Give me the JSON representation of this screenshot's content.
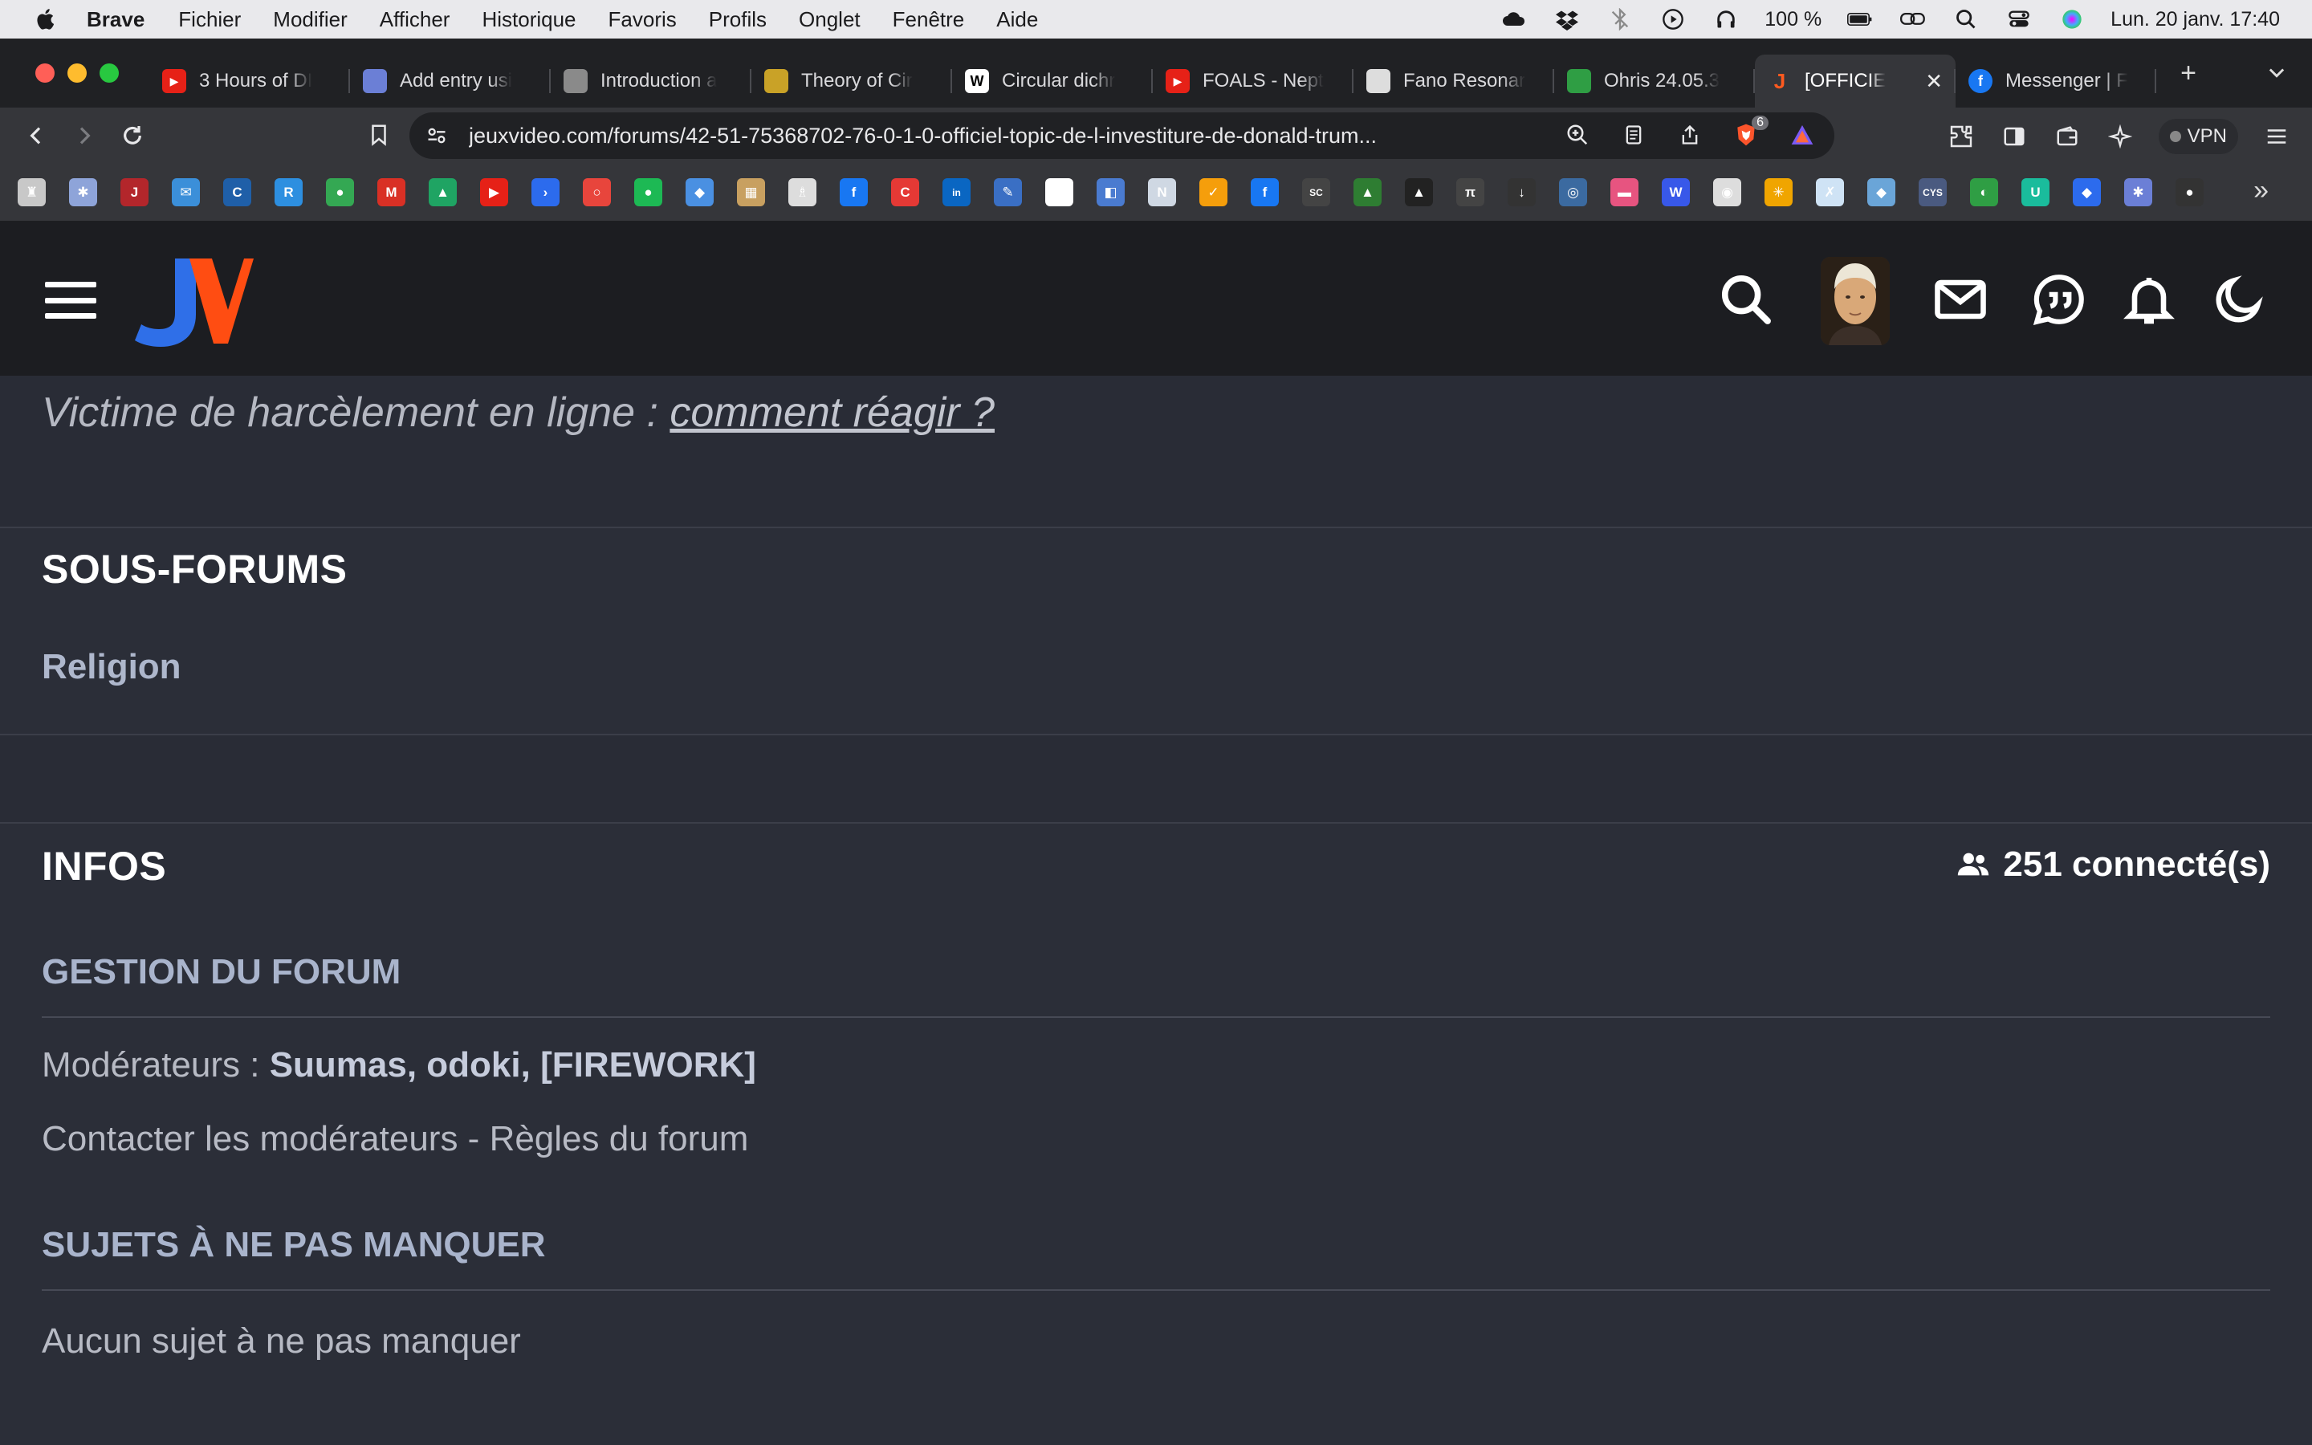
{
  "menubar": {
    "app": "Brave",
    "items": [
      "Fichier",
      "Modifier",
      "Afficher",
      "Historique",
      "Favoris",
      "Profils",
      "Onglet",
      "Fenêtre",
      "Aide"
    ],
    "battery": "100 %",
    "datetime": "Lun. 20 janv.  17:40"
  },
  "tabs": [
    {
      "label": "3 Hours of DI",
      "icon": "youtube-icon",
      "color": "#e62117"
    },
    {
      "label": "Add entry usi",
      "icon": "zotero-icon",
      "color": "#6b7fd6"
    },
    {
      "label": "Introduction a",
      "icon": "globe-icon",
      "color": "#8a8a8a"
    },
    {
      "label": "Theory of Cir",
      "icon": "compass-icon",
      "color": "#c9a227"
    },
    {
      "label": "Circular dichr",
      "icon": "wikipedia-icon",
      "color": "#ffffff"
    },
    {
      "label": "FOALS - Nept",
      "icon": "youtube-icon",
      "color": "#e62117"
    },
    {
      "label": "Fano Resonar",
      "icon": "document-icon",
      "color": "#dddddd"
    },
    {
      "label": "Ohris 24.05.3",
      "icon": "ohris-icon",
      "color": "#2f9e44"
    },
    {
      "label": "[OFFICIE",
      "icon": "jv-icon",
      "color": "#ff5a1f",
      "active": true
    },
    {
      "label": "Messenger | F",
      "icon": "facebook-icon",
      "color": "#1877f2"
    }
  ],
  "address": {
    "url": "jeuxvideo.com/forums/42-51-75368702-76-0-1-0-officiel-topic-de-l-investiture-de-donald-trum...",
    "brave_badge": "6",
    "vpn_label": "VPN"
  },
  "bookmarks": [
    {
      "icon": "bookmark-1-icon",
      "color": "#c8c8c8",
      "glyph": "♜"
    },
    {
      "icon": "bookmark-2-icon",
      "color": "#8ea4d9",
      "glyph": "✱"
    },
    {
      "icon": "bookmark-3-icon",
      "color": "#b3262b",
      "glyph": "J"
    },
    {
      "icon": "bookmark-4-icon",
      "color": "#3b8fd9",
      "glyph": "✉"
    },
    {
      "icon": "bookmark-5-icon",
      "color": "#1f5fa8",
      "glyph": "C"
    },
    {
      "icon": "bookmark-6-icon",
      "color": "#2d8fe0",
      "glyph": "R"
    },
    {
      "icon": "maps-icon",
      "color": "#34a853",
      "glyph": "●"
    },
    {
      "icon": "gmail-icon",
      "color": "#d93025",
      "glyph": "M"
    },
    {
      "icon": "drive-icon",
      "color": "#1fa463",
      "glyph": "▲"
    },
    {
      "icon": "youtube-icon",
      "color": "#e62117",
      "glyph": "▶"
    },
    {
      "icon": "bookmark-11-icon",
      "color": "#2c6bed",
      "glyph": "›"
    },
    {
      "icon": "bookmark-12-icon",
      "color": "#e8453c",
      "glyph": "○"
    },
    {
      "icon": "bookmark-13-icon",
      "color": "#1db954",
      "glyph": "●"
    },
    {
      "icon": "bookmark-14-icon",
      "color": "#4a90e2",
      "glyph": "◆"
    },
    {
      "icon": "bookmark-15-icon",
      "color": "#c8a060",
      "glyph": "▦"
    },
    {
      "icon": "bookmark-16-icon",
      "color": "#dddddd",
      "glyph": "♗"
    },
    {
      "icon": "facebook-icon",
      "color": "#1877f2",
      "glyph": "f"
    },
    {
      "icon": "bookmark-18-icon",
      "color": "#e53935",
      "glyph": "C"
    },
    {
      "icon": "linkedin-icon",
      "color": "#0a66c2",
      "glyph": "in"
    },
    {
      "icon": "bookmark-20-icon",
      "color": "#3a6fc4",
      "glyph": "✎"
    },
    {
      "icon": "bookmark-21-icon",
      "color": "#ffffff",
      "glyph": "A"
    },
    {
      "icon": "bookmark-22-icon",
      "color": "#4a7bd0",
      "glyph": "◧"
    },
    {
      "icon": "news-icon",
      "color": "#cfd8e3",
      "glyph": "N"
    },
    {
      "icon": "bookmark-24-icon",
      "color": "#f59e0b",
      "glyph": "✓"
    },
    {
      "icon": "facebook-icon",
      "color": "#1877f2",
      "glyph": "f"
    },
    {
      "icon": "bookmark-26-icon",
      "color": "#444444",
      "glyph": "SC"
    },
    {
      "icon": "bookmark-27-icon",
      "color": "#2e7d32",
      "glyph": "▲"
    },
    {
      "icon": "bookmark-28-icon",
      "color": "#222222",
      "glyph": "▲"
    },
    {
      "icon": "bookmark-29-icon",
      "color": "#444444",
      "glyph": "π"
    },
    {
      "icon": "bookmark-30-icon",
      "color": "#333333",
      "glyph": "↓"
    },
    {
      "icon": "bookmark-31-icon",
      "color": "#3b6aa0",
      "glyph": "◎"
    },
    {
      "icon": "bookmark-32-icon",
      "color": "#e75480",
      "glyph": "▬"
    },
    {
      "icon": "wordpress-icon",
      "color": "#3858e9",
      "glyph": "W"
    },
    {
      "icon": "bookmark-34-icon",
      "color": "#dddddd",
      "glyph": "◉"
    },
    {
      "icon": "bookmark-35-icon",
      "color": "#f0a500",
      "glyph": "✳"
    },
    {
      "icon": "bookmark-36-icon",
      "color": "#cfe3f5",
      "glyph": "✗"
    },
    {
      "icon": "bookmark-37-icon",
      "color": "#6aa5d8",
      "glyph": "◆"
    },
    {
      "icon": "bookmark-38-icon",
      "color": "#4a5a80",
      "glyph": "CYS"
    },
    {
      "icon": "bookmark-39-icon",
      "color": "#2f9e44",
      "glyph": "◐"
    },
    {
      "icon": "bookmark-40-icon",
      "color": "#1abc9c",
      "glyph": "U"
    },
    {
      "icon": "bookmark-41-icon",
      "color": "#2c6bed",
      "glyph": "◆"
    },
    {
      "icon": "bookmark-42-icon",
      "color": "#6b7fd6",
      "glyph": "✱"
    },
    {
      "icon": "bookmark-43-icon",
      "color": "#333333",
      "glyph": "●"
    }
  ],
  "page": {
    "harassment_prefix": "Victime de harcèlement en ligne : ",
    "harassment_link": "comment réagir ?",
    "subforums_title": "SOUS-FORUMS",
    "subforums": [
      "Religion"
    ],
    "infos_title": "INFOS",
    "connected": "251 connecté(s)",
    "management_title": "GESTION DU FORUM",
    "moderators_label": "Modérateurs : ",
    "moderators": "Suumas, odoki, [FIREWORK]",
    "contact_line": "Contacter les modérateurs - Règles du forum",
    "must_see_title": "SUJETS À NE PAS MANQUER",
    "must_see_empty": "Aucun sujet à ne pas manquer"
  },
  "colors": {
    "logo_blue": "#2f6fe8",
    "logo_orange": "#ff4d12",
    "page_bg": "#292c36"
  }
}
